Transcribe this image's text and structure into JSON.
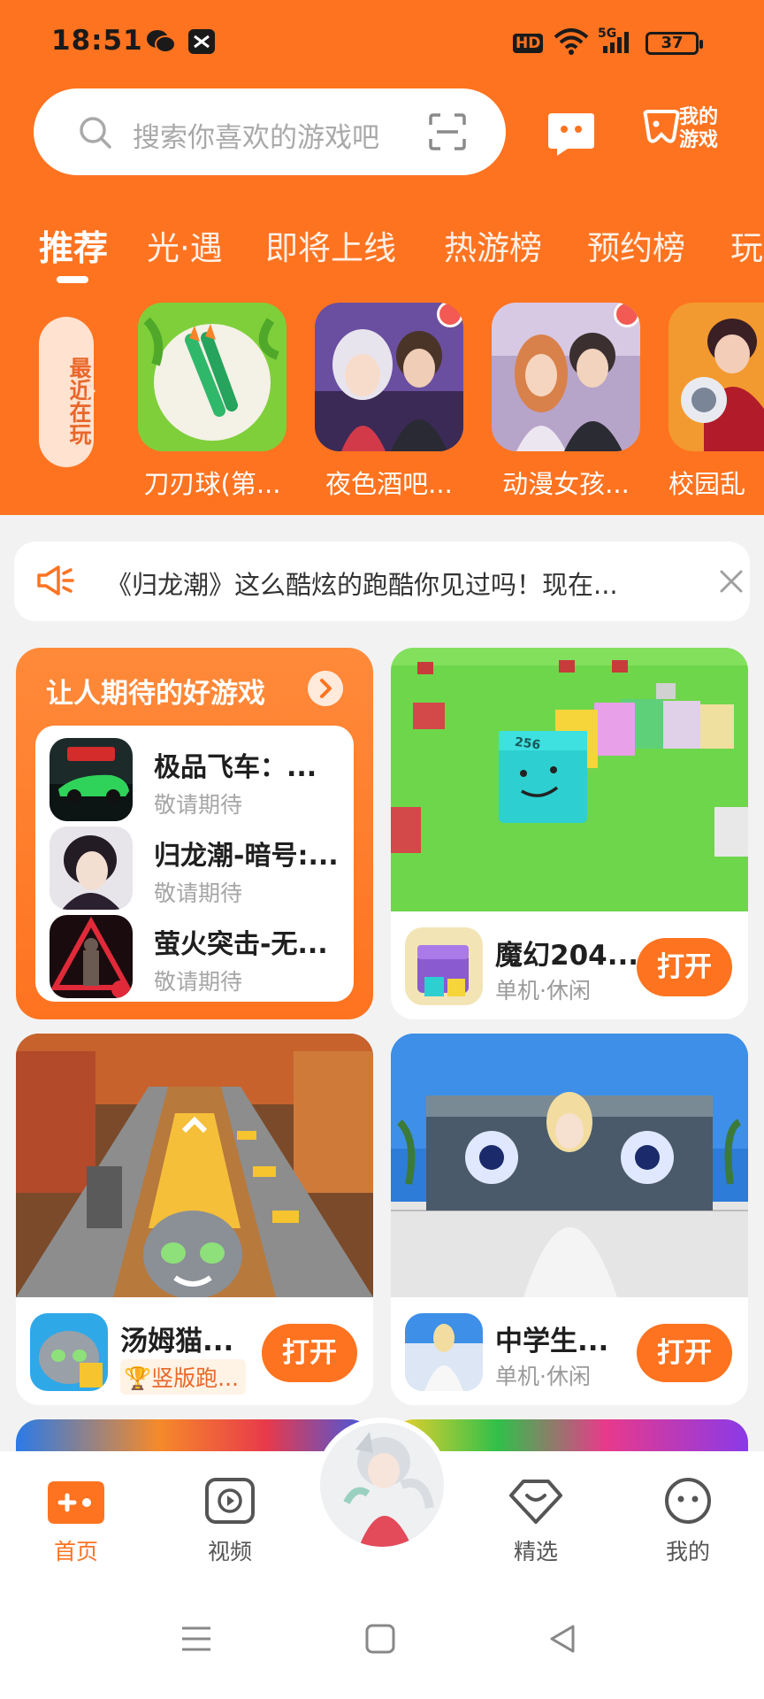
{
  "status_bar": {
    "time": "18:51",
    "battery": "37",
    "hd": "HD",
    "signal": "5G"
  },
  "search": {
    "placeholder": "搜索你喜欢的游戏吧"
  },
  "header": {
    "my_games_line1": "我的",
    "my_games_line2": "游戏"
  },
  "tabs": [
    "推荐",
    "光·遇",
    "即将上线",
    "热游榜",
    "预约榜",
    "玩"
  ],
  "active_tab": "推荐",
  "recent": {
    "label": "最近在玩",
    "items": [
      {
        "name": "刀刃球(第...",
        "has_dot": false
      },
      {
        "name": "夜色酒吧...",
        "has_dot": true
      },
      {
        "name": "动漫女孩...",
        "has_dot": true
      },
      {
        "name": "校园乱",
        "has_dot": false
      }
    ]
  },
  "notice": {
    "text": "《归龙潮》这么酷炫的跑酷你见过吗！现在..."
  },
  "promo": {
    "title": "让人期待的好游戏",
    "items": [
      {
        "name": "极品飞车：...",
        "status": "敬请期待"
      },
      {
        "name": "归龙潮-暗号:...",
        "status": "敬请期待"
      },
      {
        "name": "萤火突击-无...",
        "status": "敬请期待"
      }
    ]
  },
  "game_cards": [
    {
      "name": "魔幻204...",
      "tag": "单机·休闲",
      "button": "打开",
      "cube_label": "256"
    },
    {
      "name": "汤姆猫...",
      "tag": "竖版跑...",
      "button": "打开"
    },
    {
      "name": "中学生...",
      "tag": "单机·休闲",
      "button": "打开"
    }
  ],
  "bottom_nav": [
    {
      "label": "首页",
      "active": true
    },
    {
      "label": "视频",
      "active": false
    },
    {
      "label": "精选",
      "active": false
    },
    {
      "label": "我的",
      "active": false
    }
  ],
  "colors": {
    "accent": "#fe7320",
    "background": "#f2f2f2"
  }
}
